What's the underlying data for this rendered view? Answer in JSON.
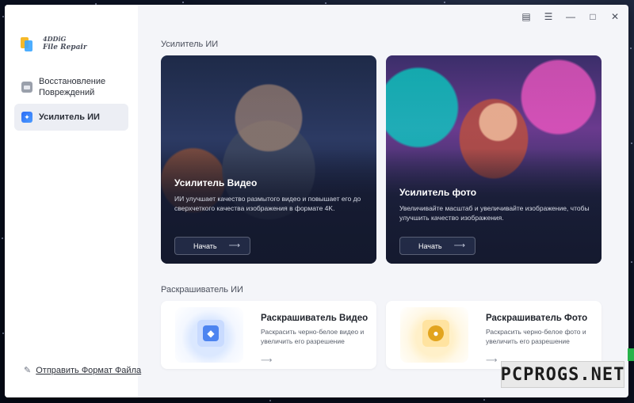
{
  "app": {
    "logo_line1": "4DDiG",
    "logo_line2": "File Repair"
  },
  "sidebar": {
    "items": [
      {
        "label": "Восстановление Повреждений",
        "icon": "folder-icon",
        "active": false
      },
      {
        "label": "Усилитель ИИ",
        "icon": "magic-wand-icon",
        "active": true
      }
    ],
    "submit_format": "Отправить Формат Файла"
  },
  "titlebar": {
    "feedback_icon": "feedback-icon",
    "menu_icon": "menu-icon",
    "minimize_icon": "minimize-icon",
    "maximize_icon": "maximize-icon",
    "close_icon": "close-icon"
  },
  "sections": {
    "enhancer_title": "Усилитель ИИ",
    "colorizer_title": "Раскрашиватель ИИ"
  },
  "enhancer": {
    "video": {
      "title": "Усилитель Видео",
      "description": "ИИ улучшает качество размытого видео и повышает его до сверхчеткого качества изображения в формате 4K.",
      "button": "Начать"
    },
    "photo": {
      "title": "Усилитель фото",
      "description": "Увеличивайте масштаб и увеличивайте изображение, чтобы улучшить качество изображения.",
      "button": "Начать"
    }
  },
  "colorizer": {
    "video": {
      "title": "Раскрашиватель Видео",
      "description": "Раскрасить черно-белое видео и увеличить его разрешение"
    },
    "photo": {
      "title": "Раскрашиватель Фото",
      "description": "Раскрасить черно-белое фото и увеличить его разрешение"
    }
  },
  "watermark": "PCPROGS.NET",
  "colors": {
    "accent": "#2d6cf5",
    "sidebar_bg": "#ffffff",
    "content_bg": "#f4f5f9"
  }
}
